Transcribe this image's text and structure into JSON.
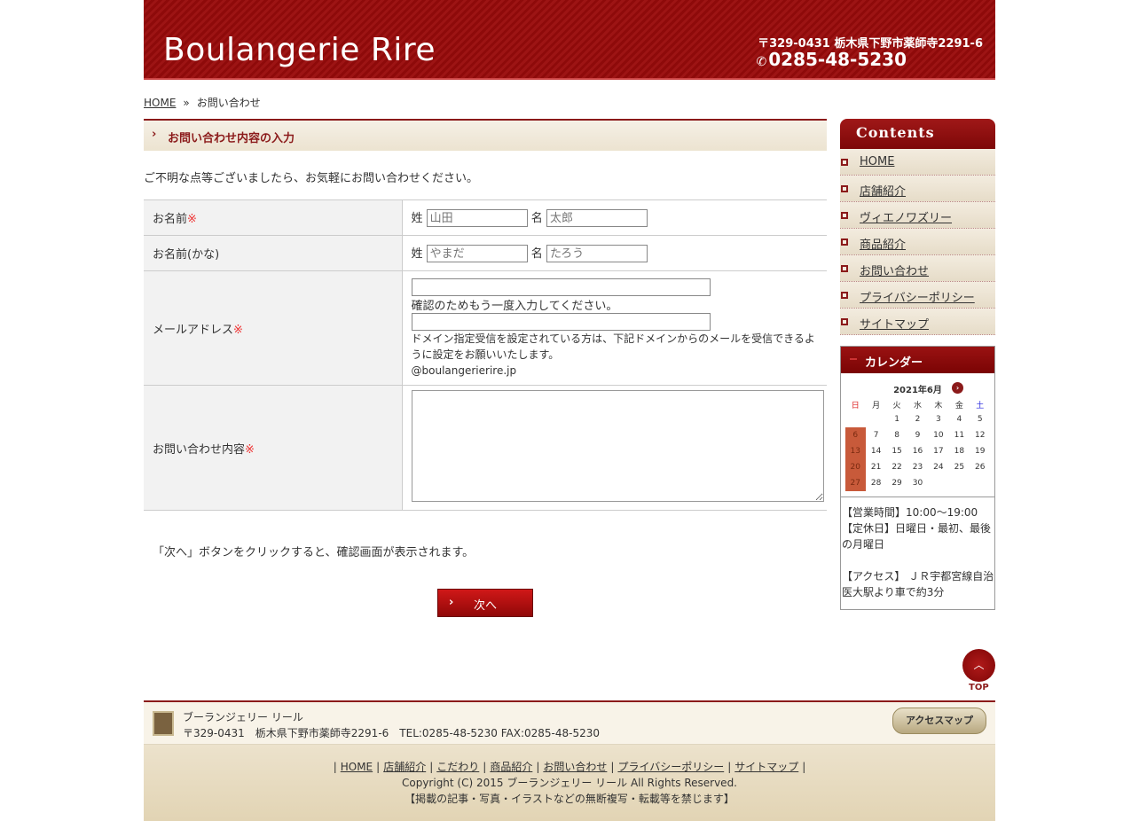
{
  "header": {
    "logo": "Boulangerie Rire",
    "address": "〒329-0431 栃木県下野市薬師寺2291-6",
    "tel": "0285-48-5230"
  },
  "breadcrumb": {
    "home": "HOME",
    "sep": "»",
    "current": "お問い合わせ"
  },
  "main": {
    "title": "お問い合わせ内容の入力",
    "intro": "ご不明な点等ございましたら、お気軽にお問い合わせください。",
    "required_mark": "※",
    "fields": {
      "name": {
        "label": "お名前",
        "sei": "姓",
        "mei": "名",
        "sei_placeholder": "山田",
        "mei_placeholder": "太郎"
      },
      "kana": {
        "label": "お名前(かな)",
        "sei": "姓",
        "mei": "名",
        "sei_placeholder": "やまだ",
        "mei_placeholder": "たろう"
      },
      "email": {
        "label": "メールアドレス",
        "confirm_text": "確認のためもう一度入力してください。",
        "domain_note": "ドメイン指定受信を設定されている方は、下記ドメインからのメールを受信できるように設定をお願いいたします。",
        "domain": "@boulangerierire.jp"
      },
      "message": {
        "label": "お問い合わせ内容"
      }
    },
    "note": "「次へ」ボタンをクリックすると、確認画面が表示されます。",
    "next_button": "次へ"
  },
  "sidebar": {
    "contents_title": "Contents",
    "nav": [
      "HOME",
      "店舗紹介",
      "ヴィエノワズリー",
      "商品紹介",
      "お問い合わせ",
      "プライバシーポリシー",
      "サイトマップ"
    ],
    "calendar": {
      "title": "カレンダー",
      "month": "2021年6月",
      "weekdays": [
        "日",
        "月",
        "火",
        "水",
        "木",
        "金",
        "土"
      ],
      "weeks": [
        [
          "",
          "",
          "1",
          "2",
          "3",
          "4",
          "5"
        ],
        [
          "6",
          "7",
          "8",
          "9",
          "10",
          "11",
          "12"
        ],
        [
          "13",
          "14",
          "15",
          "16",
          "17",
          "18",
          "19"
        ],
        [
          "20",
          "21",
          "22",
          "23",
          "24",
          "25",
          "26"
        ],
        [
          "27",
          "28",
          "29",
          "30",
          "",
          "",
          ""
        ]
      ],
      "closed_days": [
        "6",
        "13",
        "20",
        "27"
      ]
    },
    "info": {
      "hours": "【営業時間】10:00～19:00",
      "holiday": "【定休日】日曜日・最初、最後の月曜日",
      "access": "【アクセス】 ＪＲ宇都宮線自治医大駅より車で約3分"
    }
  },
  "top_button": "TOP",
  "footer": {
    "shop_name": "ブーランジェリー リール",
    "address_line": "〒329-0431　栃木県下野市薬師寺2291-6　TEL:0285-48-5230 FAX:0285-48-5230",
    "map_button": "アクセスマップ",
    "links": [
      "HOME",
      "店舗紹介",
      "こだわり",
      "商品紹介",
      "お問い合わせ",
      "プライバシーポリシー",
      "サイトマップ"
    ],
    "copyright": "Copyright (C) 2015 ブーランジェリー リール All Rights Reserved.",
    "notice": "【掲載の記事・写真・イラストなどの無断複写・転載等を禁じます】"
  },
  "colors": {
    "brand": "#8b1a1a",
    "required": "#ee3333",
    "closed_day": "#c85a3a"
  }
}
